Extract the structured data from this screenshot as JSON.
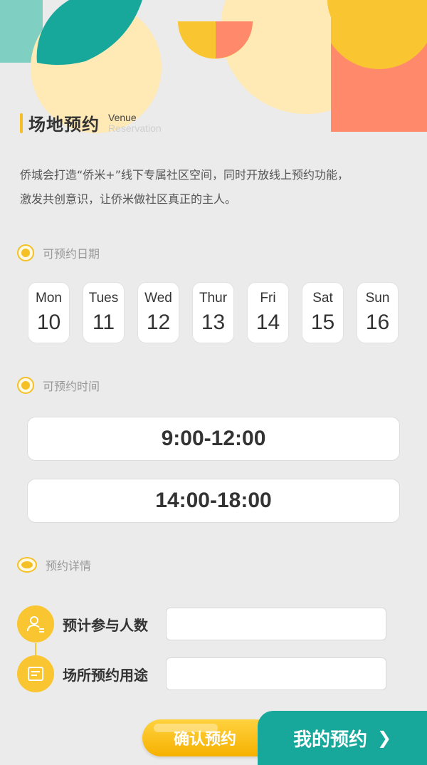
{
  "colors": {
    "background": "#ebebeb",
    "accent_yellow": "#f5c026",
    "teal": "#17a89b",
    "coral": "#ff8a6b",
    "cream": "#ffe9b4"
  },
  "header": {
    "title_cn": "场地预约",
    "title_en_line1": "Venue",
    "title_en_line2": "Reservation"
  },
  "intro": {
    "line1": "侨城会打造“侨米+”线下专属社区空间，同时开放线上预约功能，",
    "line2": "激发共创意识，让侨米做社区真正的主人。"
  },
  "sections": {
    "dates_label": "可预约日期",
    "times_label": "可预约时间",
    "details_label": "预约详情"
  },
  "days": [
    {
      "name": "Mon",
      "num": "10"
    },
    {
      "name": "Tues",
      "num": "11"
    },
    {
      "name": "Wed",
      "num": "12"
    },
    {
      "name": "Thur",
      "num": "13"
    },
    {
      "name": "Fri",
      "num": "14"
    },
    {
      "name": "Sat",
      "num": "15"
    },
    {
      "name": "Sun",
      "num": "16"
    }
  ],
  "slots": [
    "9:00-12:00",
    "14:00-18:00"
  ],
  "details": {
    "participants_label": "预计参与人数",
    "participants_value": "",
    "purpose_label": "场所预约用途",
    "purpose_value": "",
    "participants_icon": "person-icon",
    "purpose_icon": "document-icon"
  },
  "actions": {
    "confirm_label": "确认预约",
    "mine_label": "我的预约",
    "mine_icon": "chevron-right-icon"
  }
}
